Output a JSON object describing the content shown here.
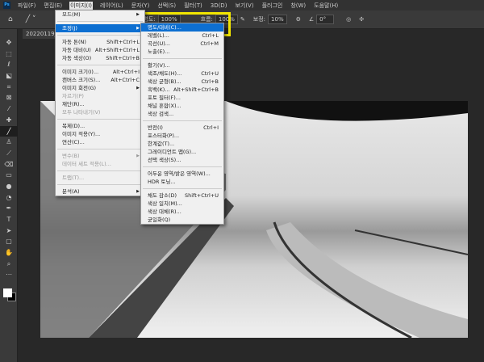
{
  "menubar": {
    "items": [
      "파일(F)",
      "편집(E)",
      "이미지(I)",
      "레이어(L)",
      "문자(Y)",
      "선택(S)",
      "필터(T)",
      "3D(D)",
      "보기(V)",
      "플러그인",
      "창(W)",
      "도움말(H)"
    ]
  },
  "options": {
    "opacity_label": "불투명도:",
    "opacity": "100%",
    "flow_label": "흐름:",
    "flow": "100%",
    "smoothing_label": "보정:",
    "smoothing": "10%",
    "angle": "0°"
  },
  "document_tab": "20220119_102",
  "image_menu": [
    {
      "label": "모드(M)",
      "arrow": true
    },
    {
      "sep": true
    },
    {
      "label": "조정(J)",
      "arrow": true,
      "highlight": true
    },
    {
      "sep": true
    },
    {
      "label": "자동 톤(N)",
      "shortcut": "Shift+Ctrl+L"
    },
    {
      "label": "자동 대비(U)",
      "shortcut": "Alt+Shift+Ctrl+L"
    },
    {
      "label": "자동 색상(O)",
      "shortcut": "Shift+Ctrl+B"
    },
    {
      "sep": true
    },
    {
      "label": "이미지 크기(I)...",
      "shortcut": "Alt+Ctrl+I"
    },
    {
      "label": "캔버스 크기(S)...",
      "shortcut": "Alt+Ctrl+C"
    },
    {
      "label": "이미지 회전(G)",
      "arrow": true
    },
    {
      "label": "자르기(P)",
      "disabled": true
    },
    {
      "label": "재단(R)..."
    },
    {
      "label": "모두 나타내기(V)",
      "disabled": true
    },
    {
      "sep": true
    },
    {
      "label": "복제(D)..."
    },
    {
      "label": "이미지 적용(Y)..."
    },
    {
      "label": "연산(C)..."
    },
    {
      "sep": true
    },
    {
      "label": "변수(B)",
      "arrow": true,
      "disabled": true
    },
    {
      "label": "데이터 세트 적용(L)...",
      "disabled": true
    },
    {
      "sep": true
    },
    {
      "label": "트랩(T)...",
      "disabled": true
    },
    {
      "sep": true
    },
    {
      "label": "분석(A)",
      "arrow": true
    }
  ],
  "adjust_menu": [
    {
      "label": "명도/대비(C)...",
      "highlight": true
    },
    {
      "label": "레벨(L)...",
      "shortcut": "Ctrl+L"
    },
    {
      "label": "곡선(U)...",
      "shortcut": "Ctrl+M"
    },
    {
      "label": "노출(E)..."
    },
    {
      "sep": true
    },
    {
      "label": "활기(V)..."
    },
    {
      "label": "색조/채도(H)...",
      "shortcut": "Ctrl+U"
    },
    {
      "label": "색상 균형(B)...",
      "shortcut": "Ctrl+B"
    },
    {
      "label": "흑백(K)...",
      "shortcut": "Alt+Shift+Ctrl+B"
    },
    {
      "label": "포토 필터(F)..."
    },
    {
      "label": "채널 혼합(X)..."
    },
    {
      "label": "색상 검색..."
    },
    {
      "sep": true
    },
    {
      "label": "반전(I)",
      "shortcut": "Ctrl+I"
    },
    {
      "label": "포스터화(P)..."
    },
    {
      "label": "한계값(T)..."
    },
    {
      "label": "그레이디언트 맵(G)..."
    },
    {
      "label": "선택 색상(S)..."
    },
    {
      "sep": true
    },
    {
      "label": "어두운 영역/밝은 영역(W)..."
    },
    {
      "label": "HDR 토닝..."
    },
    {
      "sep": true
    },
    {
      "label": "채도 감소(D)",
      "shortcut": "Shift+Ctrl+U"
    },
    {
      "label": "색상 일치(M)..."
    },
    {
      "label": "색상 대체(R)..."
    },
    {
      "label": "균일화(Q)"
    }
  ],
  "tools": [
    "move",
    "marquee",
    "lasso",
    "object-select",
    "crop",
    "frame",
    "eyedropper",
    "healing",
    "brush",
    "stamp",
    "history-brush",
    "eraser",
    "gradient",
    "blur",
    "dodge",
    "pen",
    "type",
    "path-select",
    "rectangle",
    "hand",
    "zoom",
    "more"
  ],
  "colors": {
    "highlight": "#0d6fd1",
    "callout": "#f2e600"
  }
}
